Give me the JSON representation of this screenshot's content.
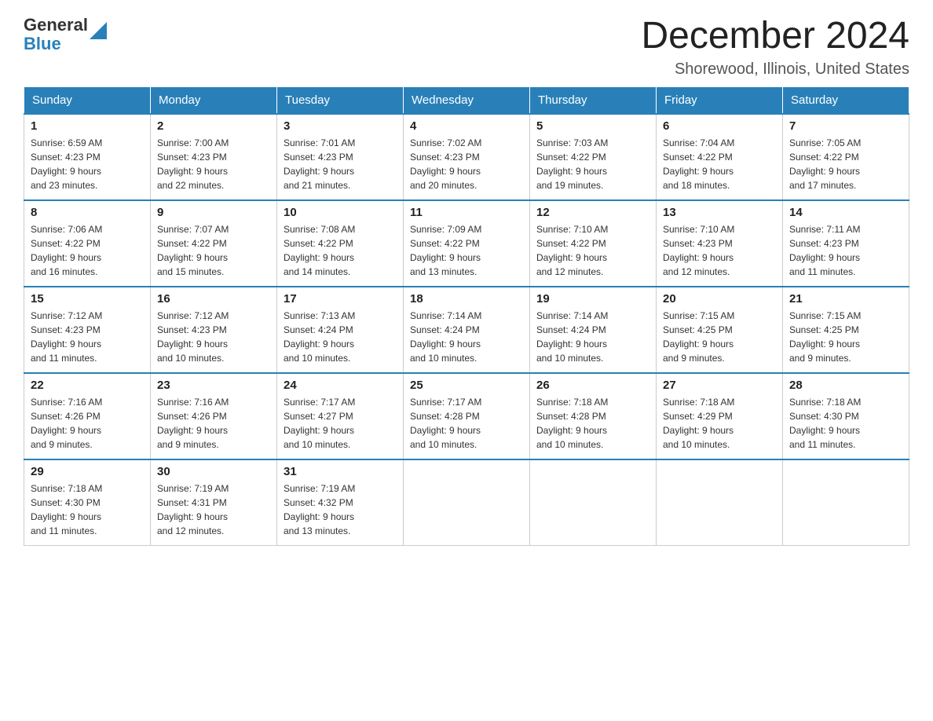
{
  "header": {
    "logo_general": "General",
    "logo_blue": "Blue",
    "title": "December 2024",
    "location": "Shorewood, Illinois, United States"
  },
  "days_of_week": [
    "Sunday",
    "Monday",
    "Tuesday",
    "Wednesday",
    "Thursday",
    "Friday",
    "Saturday"
  ],
  "weeks": [
    [
      {
        "day": "1",
        "sunrise": "6:59 AM",
        "sunset": "4:23 PM",
        "daylight": "9 hours and 23 minutes."
      },
      {
        "day": "2",
        "sunrise": "7:00 AM",
        "sunset": "4:23 PM",
        "daylight": "9 hours and 22 minutes."
      },
      {
        "day": "3",
        "sunrise": "7:01 AM",
        "sunset": "4:23 PM",
        "daylight": "9 hours and 21 minutes."
      },
      {
        "day": "4",
        "sunrise": "7:02 AM",
        "sunset": "4:23 PM",
        "daylight": "9 hours and 20 minutes."
      },
      {
        "day": "5",
        "sunrise": "7:03 AM",
        "sunset": "4:22 PM",
        "daylight": "9 hours and 19 minutes."
      },
      {
        "day": "6",
        "sunrise": "7:04 AM",
        "sunset": "4:22 PM",
        "daylight": "9 hours and 18 minutes."
      },
      {
        "day": "7",
        "sunrise": "7:05 AM",
        "sunset": "4:22 PM",
        "daylight": "9 hours and 17 minutes."
      }
    ],
    [
      {
        "day": "8",
        "sunrise": "7:06 AM",
        "sunset": "4:22 PM",
        "daylight": "9 hours and 16 minutes."
      },
      {
        "day": "9",
        "sunrise": "7:07 AM",
        "sunset": "4:22 PM",
        "daylight": "9 hours and 15 minutes."
      },
      {
        "day": "10",
        "sunrise": "7:08 AM",
        "sunset": "4:22 PM",
        "daylight": "9 hours and 14 minutes."
      },
      {
        "day": "11",
        "sunrise": "7:09 AM",
        "sunset": "4:22 PM",
        "daylight": "9 hours and 13 minutes."
      },
      {
        "day": "12",
        "sunrise": "7:10 AM",
        "sunset": "4:22 PM",
        "daylight": "9 hours and 12 minutes."
      },
      {
        "day": "13",
        "sunrise": "7:10 AM",
        "sunset": "4:23 PM",
        "daylight": "9 hours and 12 minutes."
      },
      {
        "day": "14",
        "sunrise": "7:11 AM",
        "sunset": "4:23 PM",
        "daylight": "9 hours and 11 minutes."
      }
    ],
    [
      {
        "day": "15",
        "sunrise": "7:12 AM",
        "sunset": "4:23 PM",
        "daylight": "9 hours and 11 minutes."
      },
      {
        "day": "16",
        "sunrise": "7:12 AM",
        "sunset": "4:23 PM",
        "daylight": "9 hours and 10 minutes."
      },
      {
        "day": "17",
        "sunrise": "7:13 AM",
        "sunset": "4:24 PM",
        "daylight": "9 hours and 10 minutes."
      },
      {
        "day": "18",
        "sunrise": "7:14 AM",
        "sunset": "4:24 PM",
        "daylight": "9 hours and 10 minutes."
      },
      {
        "day": "19",
        "sunrise": "7:14 AM",
        "sunset": "4:24 PM",
        "daylight": "9 hours and 10 minutes."
      },
      {
        "day": "20",
        "sunrise": "7:15 AM",
        "sunset": "4:25 PM",
        "daylight": "9 hours and 9 minutes."
      },
      {
        "day": "21",
        "sunrise": "7:15 AM",
        "sunset": "4:25 PM",
        "daylight": "9 hours and 9 minutes."
      }
    ],
    [
      {
        "day": "22",
        "sunrise": "7:16 AM",
        "sunset": "4:26 PM",
        "daylight": "9 hours and 9 minutes."
      },
      {
        "day": "23",
        "sunrise": "7:16 AM",
        "sunset": "4:26 PM",
        "daylight": "9 hours and 9 minutes."
      },
      {
        "day": "24",
        "sunrise": "7:17 AM",
        "sunset": "4:27 PM",
        "daylight": "9 hours and 10 minutes."
      },
      {
        "day": "25",
        "sunrise": "7:17 AM",
        "sunset": "4:28 PM",
        "daylight": "9 hours and 10 minutes."
      },
      {
        "day": "26",
        "sunrise": "7:18 AM",
        "sunset": "4:28 PM",
        "daylight": "9 hours and 10 minutes."
      },
      {
        "day": "27",
        "sunrise": "7:18 AM",
        "sunset": "4:29 PM",
        "daylight": "9 hours and 10 minutes."
      },
      {
        "day": "28",
        "sunrise": "7:18 AM",
        "sunset": "4:30 PM",
        "daylight": "9 hours and 11 minutes."
      }
    ],
    [
      {
        "day": "29",
        "sunrise": "7:18 AM",
        "sunset": "4:30 PM",
        "daylight": "9 hours and 11 minutes."
      },
      {
        "day": "30",
        "sunrise": "7:19 AM",
        "sunset": "4:31 PM",
        "daylight": "9 hours and 12 minutes."
      },
      {
        "day": "31",
        "sunrise": "7:19 AM",
        "sunset": "4:32 PM",
        "daylight": "9 hours and 13 minutes."
      },
      null,
      null,
      null,
      null
    ]
  ],
  "labels": {
    "sunrise": "Sunrise:",
    "sunset": "Sunset:",
    "daylight": "Daylight:"
  }
}
